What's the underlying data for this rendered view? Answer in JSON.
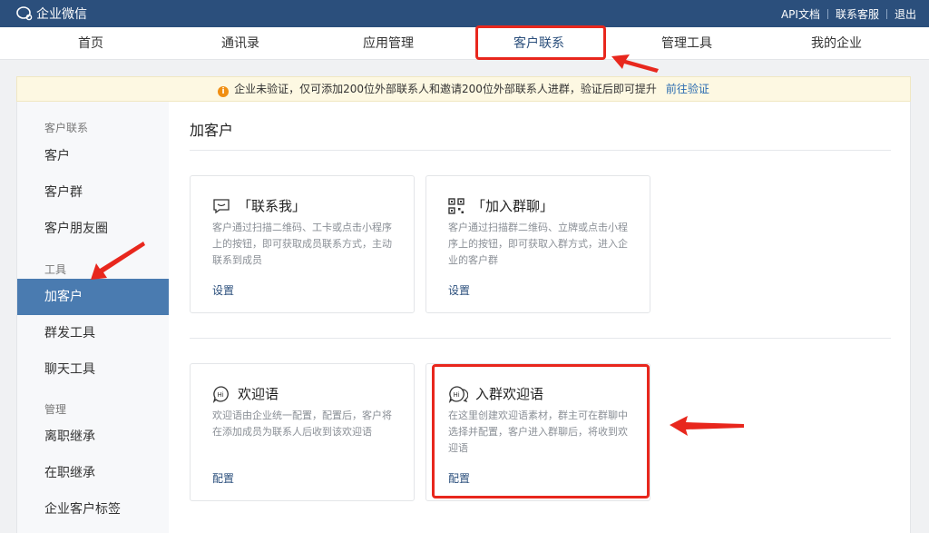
{
  "topbar": {
    "app_name": "企业微信",
    "links": [
      "API文档",
      "联系客服",
      "退出"
    ]
  },
  "mainnav": {
    "items": [
      "首页",
      "通讯录",
      "应用管理",
      "客户联系",
      "管理工具",
      "我的企业"
    ],
    "active": "客户联系"
  },
  "notice": {
    "text": "企业未验证，仅可添加200位外部联系人和邀请200位外部联系人进群，验证后即可提升",
    "link": "前往验证",
    "icon": "warning-icon"
  },
  "sidebar": {
    "groups": [
      {
        "title": "客户联系",
        "items": [
          "客户",
          "客户群",
          "客户朋友圈"
        ]
      },
      {
        "title": "工具",
        "items": [
          "加客户",
          "群发工具",
          "聊天工具"
        ]
      },
      {
        "title": "管理",
        "items": [
          "离职继承",
          "在职继承",
          "企业客户标签"
        ]
      }
    ],
    "active": "加客户"
  },
  "main": {
    "title": "加客户",
    "cards": [
      {
        "icon": "chat-bubble-icon",
        "title": "「联系我」",
        "desc": "客户通过扫描二维码、工卡或点击小程序上的按钮，即可获取成员联系方式，主动联系到成员",
        "link": "设置"
      },
      {
        "icon": "qr-code-icon",
        "title": "「加入群聊」",
        "desc": "客户通过扫描群二维码、立牌或点击小程序上的按钮，即可获取入群方式，进入企业的客户群",
        "link": "设置"
      },
      {
        "icon": "hi-bubble-icon",
        "title": "欢迎语",
        "desc": "欢迎语由企业统一配置，配置后，客户将在添加成员为联系人后收到该欢迎语",
        "link": "配置"
      },
      {
        "icon": "hi-group-bubble-icon",
        "title": "入群欢迎语",
        "desc": "在这里创建欢迎语素材，群主可在群聊中选择并配置，客户进入群聊后，将收到欢迎语",
        "link": "配置"
      }
    ]
  },
  "colors": {
    "topbar": "#2b4f7c",
    "sidebar_active": "#4a7bb0",
    "annotation_red": "#e8271d",
    "link": "#2b4f7c"
  }
}
